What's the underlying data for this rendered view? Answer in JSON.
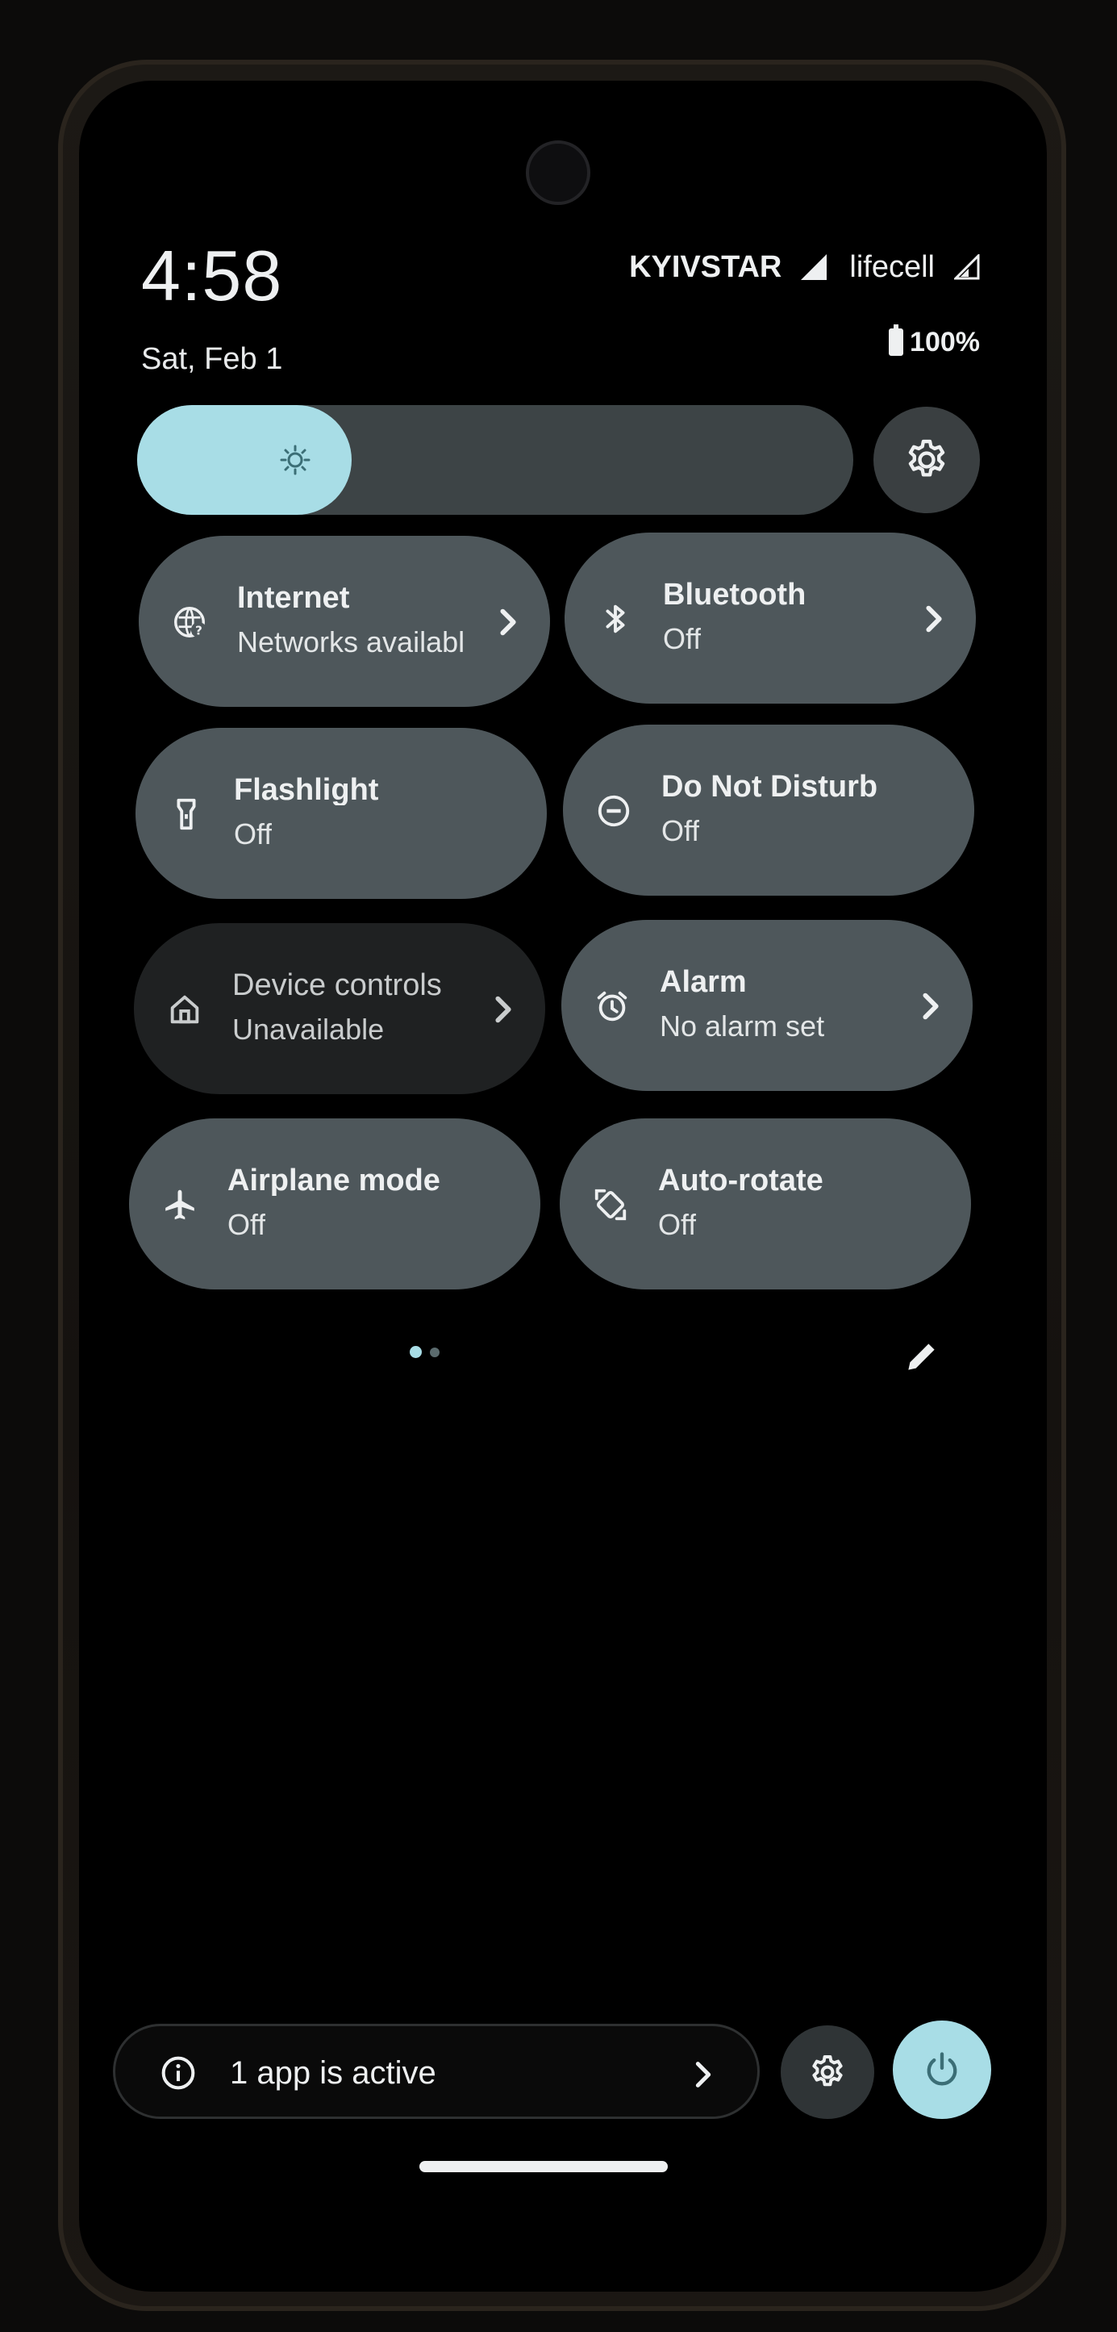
{
  "status_bar": {
    "time": "4:58",
    "date": "Sat, Feb 1",
    "carrier_1": "KYIVSTAR",
    "carrier_2": "lifecell",
    "battery": "100%"
  },
  "brightness": {
    "level": 0.3,
    "icon": "brightness-icon",
    "settings_icon": "gear-icon"
  },
  "tiles": [
    {
      "title": "Internet",
      "subtitle": "Networks available",
      "icon": "wifi-question-icon",
      "active": true,
      "chevron": true
    },
    {
      "title": "Bluetooth",
      "subtitle": "Off",
      "icon": "bluetooth-icon",
      "active": true,
      "chevron": true
    },
    {
      "title": "Flashlight",
      "subtitle": "Off",
      "icon": "flashlight-icon",
      "active": true,
      "chevron": false
    },
    {
      "title": "Do Not Disturb",
      "subtitle": "Off",
      "icon": "do-not-disturb-icon",
      "active": true,
      "chevron": false
    },
    {
      "title": "Device controls",
      "subtitle": "Unavailable",
      "icon": "home-icon",
      "active": false,
      "chevron": true
    },
    {
      "title": "Alarm",
      "subtitle": "No alarm set",
      "icon": "alarm-icon",
      "active": true,
      "chevron": true
    },
    {
      "title": "Airplane mode",
      "subtitle": "Off",
      "icon": "airplane-icon",
      "active": true,
      "chevron": false
    },
    {
      "title": "Auto-rotate",
      "subtitle": "Off",
      "icon": "auto-rotate-icon",
      "active": true,
      "chevron": false
    }
  ],
  "pager": {
    "pages": 2,
    "current": 1
  },
  "footer": {
    "active_apps_label": "1 app is active",
    "settings_icon": "gear-icon",
    "power_icon": "power-icon"
  },
  "colors": {
    "accent": "#a8dde6",
    "tile": "#4e575b",
    "tile_unavailable": "#1f2122",
    "background": "#000000"
  }
}
